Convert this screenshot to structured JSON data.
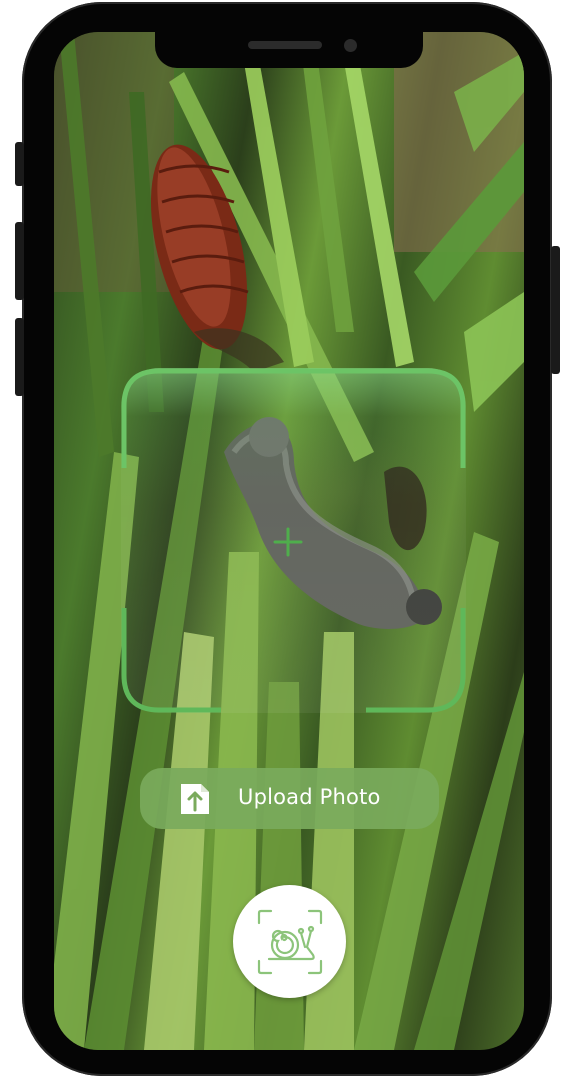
{
  "app": {
    "screen": "pest-scanner-camera"
  },
  "camera_view": {
    "subject": ""
  },
  "scan_overlay": {
    "reticle_icon": "plus-crosshair-icon",
    "accent_color": "#5fb85a"
  },
  "upload": {
    "label": "Upload Photo",
    "icon": "upload-arrow-icon",
    "background_color": "#7aaa5c"
  },
  "capture": {
    "icon": "snail-scan-icon",
    "icon_color": "#8cc47a"
  }
}
